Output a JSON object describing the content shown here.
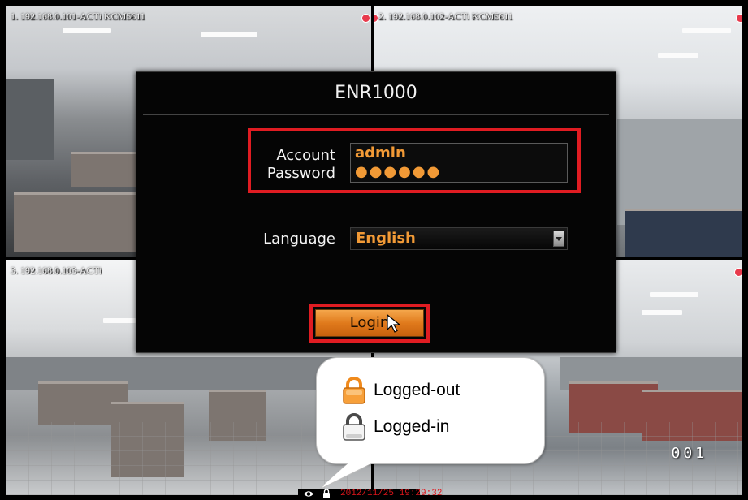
{
  "cameras": [
    {
      "label": "1. 192.168.0.101-ACTi KCM5611"
    },
    {
      "label": "2. 192.168.0.102-ACTi KCM5611"
    },
    {
      "label": "3. 192.168.0.103-ACTi"
    },
    {
      "label": ""
    }
  ],
  "login_dialog": {
    "title": "ENR1000",
    "account_label": "Account",
    "account_value": "admin",
    "password_label": "Password",
    "password_value": "●●●●●●",
    "language_label": "Language",
    "language_value": "English",
    "login_button": "Login"
  },
  "legend": {
    "logged_out": "Logged-out",
    "logged_in": "Logged-in"
  },
  "status_bar": {
    "timestamp": "2012/11/25 19:29:32"
  },
  "channel_number": "001",
  "colors": {
    "accent_orange": "#f29a36",
    "highlight_red": "#e01c22",
    "timestamp_red": "#e0161b",
    "record_dot": "#e83a4c"
  },
  "icons": {
    "logged_out": "orange-padlock-icon",
    "logged_in": "gray-padlock-icon",
    "cursor": "mouse-cursor-icon",
    "status_view": "eye-icon",
    "status_lock": "lock-icon"
  }
}
